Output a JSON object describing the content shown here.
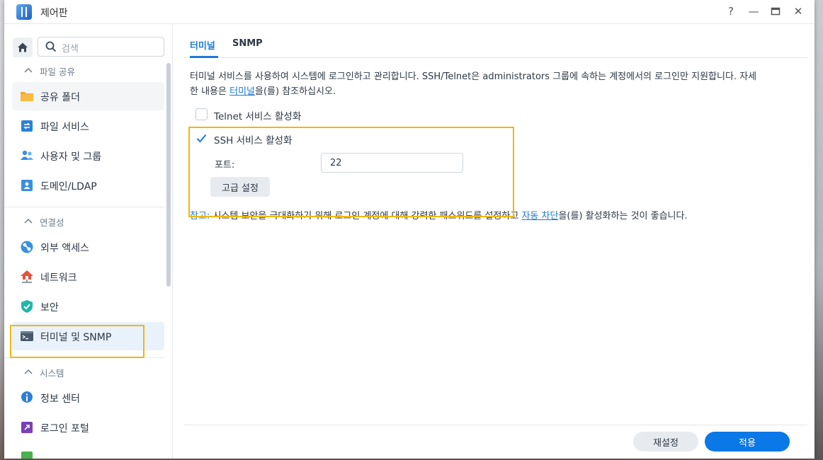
{
  "window": {
    "title": "제어판",
    "help": "?",
    "minimize": "—",
    "maximize": "▭",
    "close": "✕"
  },
  "sidebar": {
    "search_placeholder": "검색",
    "sections": [
      {
        "label": "파일 공유",
        "items": [
          {
            "label": "공유 폴더",
            "icon": "folder-icon"
          },
          {
            "label": "파일 서비스",
            "icon": "file-services-icon"
          },
          {
            "label": "사용자 및 그룹",
            "icon": "users-icon"
          },
          {
            "label": "도메인/LDAP",
            "icon": "domain-icon"
          }
        ]
      },
      {
        "label": "연결성",
        "items": [
          {
            "label": "외부 액세스",
            "icon": "external-access-icon"
          },
          {
            "label": "네트워크",
            "icon": "network-icon"
          },
          {
            "label": "보안",
            "icon": "shield-icon"
          },
          {
            "label": "터미널 및 SNMP",
            "icon": "terminal-icon",
            "active": true
          }
        ]
      },
      {
        "label": "시스템",
        "items": [
          {
            "label": "정보 센터",
            "icon": "info-icon"
          },
          {
            "label": "로그인 포털",
            "icon": "login-portal-icon"
          }
        ]
      }
    ]
  },
  "main": {
    "tabs": [
      {
        "label": "터미널",
        "active": true
      },
      {
        "label": "SNMP"
      }
    ],
    "description_part1": "터미널 서비스를 사용하여 시스템에 로그인하고 관리합니다. SSH/Telnet은 administrators 그룹에 속하는 계정에서의 로그인만 지원합니다. 자세",
    "description_part2": "한 내용은 ",
    "description_link": "터미널",
    "description_part3": "을(를) 참조하십시오.",
    "telnet_label": "Telnet 서비스 활성화",
    "telnet_checked": false,
    "ssh_label": "SSH 서비스 활성화",
    "ssh_checked": true,
    "port_label": "포트:",
    "port_value": "22",
    "advanced_button": "고급 설정",
    "note_label": "참고:",
    "note_text1": " 시스템 보안을 극대화하기 위해 로그인 계정에 대해 강력한 패스워드를 설정하고 ",
    "note_link": "자동 차단",
    "note_text2": "을(를) 활성화하는 것이 좋습니다.",
    "reset_button": "재설정",
    "apply_button": "적용"
  },
  "colors": {
    "accent": "#1e7ad4",
    "highlight": "#f2b70a",
    "apply": "#0a78e6"
  }
}
